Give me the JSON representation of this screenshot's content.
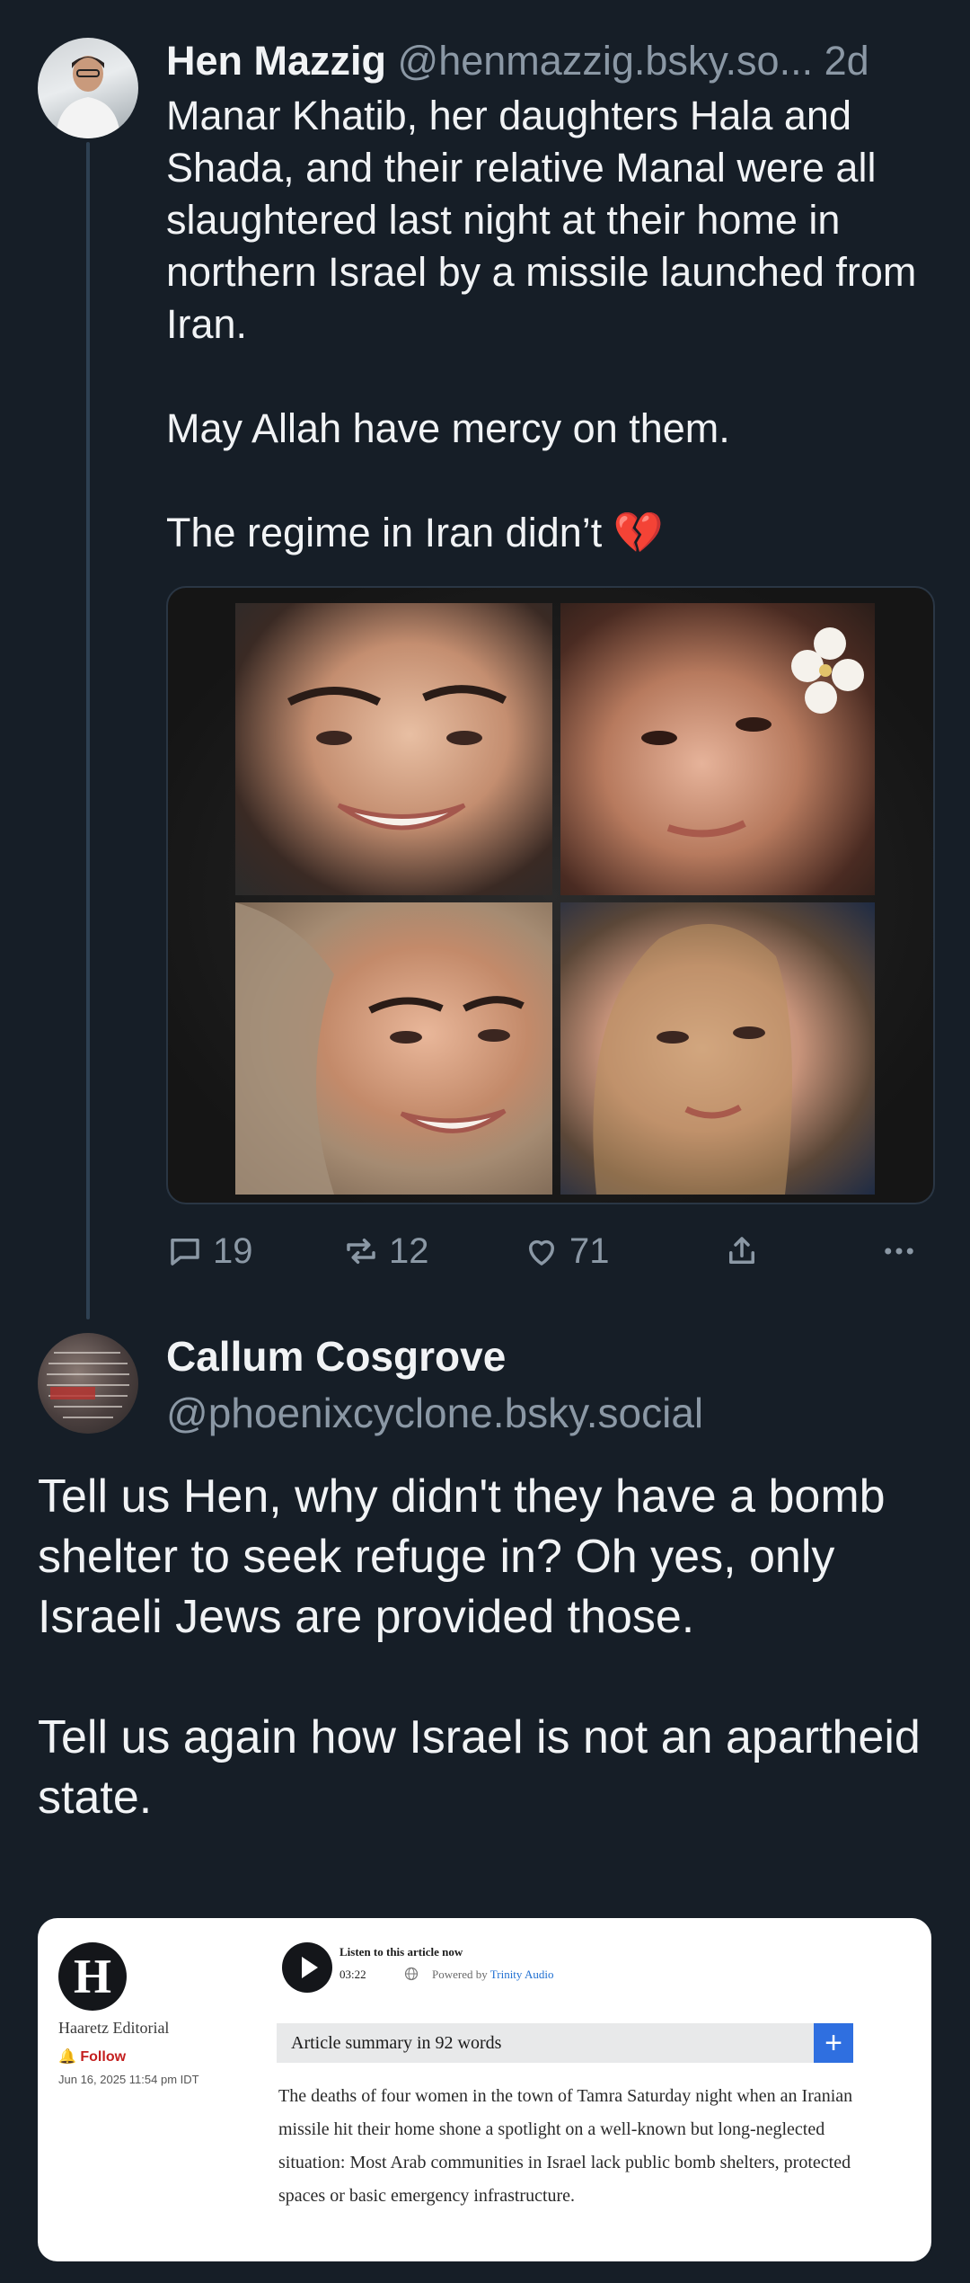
{
  "post1": {
    "author_name": "Hen Mazzig",
    "handle": "@henmazzig.bsky.so...",
    "time": "2d",
    "text": [
      "Manar Khatib, her daughters Hala and Shada, and their relative Manal were all slaughtered last night at their home in northern Israel by a missile launched from Iran.",
      "May Allah have mercy on them.",
      "The regime in Iran didn’t 💔"
    ],
    "media": "photo-grid-four-women",
    "actions": {
      "replies": "19",
      "reposts": "12",
      "likes": "71"
    }
  },
  "post2": {
    "author_name": "Callum Cosgrove",
    "handle": "@phoenixcyclone.bsky.social",
    "text": [
      "Tell us Hen, why didn't they have a bomb shelter to seek refuge in? Oh yes, only Israeli Jews are provided those.",
      "Tell us again how Israel is not an apartheid state."
    ]
  },
  "embed": {
    "logo_letter": "H",
    "publisher": "Haaretz Editorial",
    "follow_label": "Follow",
    "date": "Jun 16, 2025 11:54 pm IDT",
    "listen_label": "Listen to this article now",
    "duration": "03:22",
    "powered_by_label": "Powered by",
    "powered_by_brand": "Trinity Audio",
    "summary_label": "Article summary in 92 words",
    "summary_text": "The deaths of four women in the town of Tamra Saturday night when an Iranian missile hit their home shone a spotlight on a well-known but long-neglected situation: Most Arab communities in Israel lack public bomb shelters, protected spaces or basic emergency infrastructure."
  },
  "colors": {
    "background": "#161e27",
    "secondary_text": "#8b98a5",
    "thread_line": "#2e4052",
    "follow_red": "#c41f1f",
    "plus_blue": "#2f6fe0"
  }
}
